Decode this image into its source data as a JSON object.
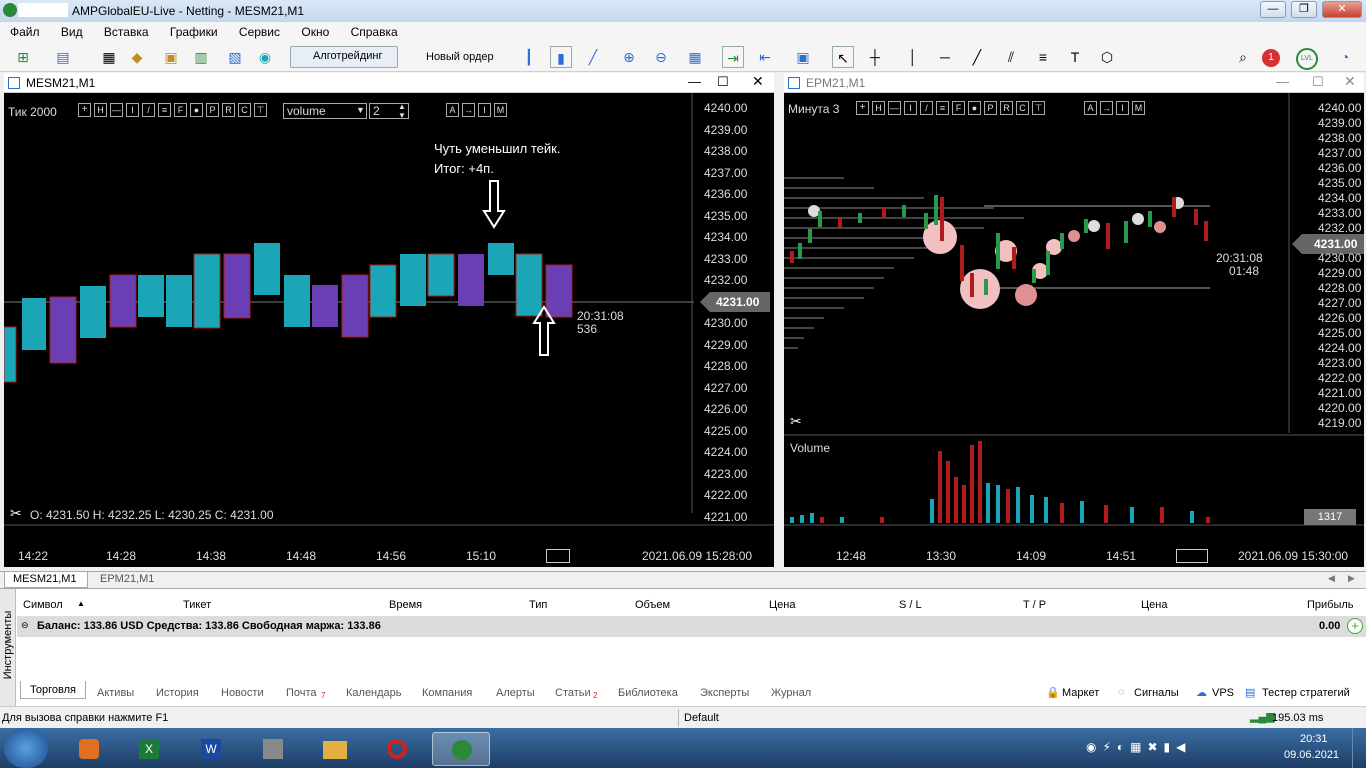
{
  "window": {
    "title": "AMPGlobalEU-Live - Netting - MESM21,M1"
  },
  "menu": [
    "Файл",
    "Вид",
    "Вставка",
    "Графики",
    "Сервис",
    "Окно",
    "Справка"
  ],
  "toolbar": {
    "algo_label": "Алготрейдинг",
    "new_order_label": "Новый ордер",
    "notif_count": "1",
    "lvl_label": "LVL"
  },
  "chart_left": {
    "title": "MESM21,M1",
    "timeframe": "Тик  2000",
    "indicator_select": "volume",
    "indicator_value": "2",
    "note_line1": "Чуть уменьшил тейк.",
    "note_line2": "Итог: +4п.",
    "ohlc": "O: 4231.50   H: 4232.25   L: 4230.25   C: 4231.00",
    "current_price": "4231.00",
    "timer": "20:31:08",
    "timer_sub": "536",
    "date_label": "2021.06.09 15:28:00",
    "price_ticks": [
      "4240.00",
      "4239.00",
      "4238.00",
      "4237.00",
      "4236.00",
      "4235.00",
      "4234.00",
      "4233.00",
      "4232.00",
      "4231.00",
      "4230.00",
      "4229.00",
      "4228.00",
      "4227.00",
      "4226.00",
      "4225.00",
      "4224.00",
      "4223.00",
      "4222.00",
      "4221.00"
    ],
    "time_ticks": [
      "14:22",
      "14:28",
      "14:38",
      "14:48",
      "14:56",
      "15:10"
    ]
  },
  "chart_right": {
    "title": "EPM21,M1",
    "timeframe": "Минута  3",
    "volume_label": "Volume",
    "current_price": "4231.00",
    "timer": "20:31:08",
    "timer_sub": "01:48",
    "volume_value": "1317",
    "date_label": "2021.06.09 15:30:00",
    "price_ticks": [
      "4240.00",
      "4239.00",
      "4238.00",
      "4237.00",
      "4236.00",
      "4235.00",
      "4234.00",
      "4233.00",
      "4232.00",
      "4231.00",
      "4230.00",
      "4229.00",
      "4228.00",
      "4227.00",
      "4226.00",
      "4225.00",
      "4224.00",
      "4223.00",
      "4222.00",
      "4221.00",
      "4220.00",
      "4219.00"
    ],
    "time_ticks": [
      "12:48",
      "13:30",
      "14:09",
      "14:51"
    ]
  },
  "chart_tabs": [
    "MESM21,M1",
    "EPM21,M1"
  ],
  "terminal": {
    "side_label": "Инструменты",
    "columns": [
      "Символ",
      "Тикет",
      "Время",
      "Тип",
      "Объем",
      "Цена",
      "S / L",
      "T / P",
      "Цена",
      "Прибыль"
    ],
    "balance_text": "Баланс: 133.86 USD  Средства: 133.86  Свободная маржа: 133.86",
    "profit": "0.00",
    "tabs": [
      "Торговля",
      "Активы",
      "История",
      "Новости",
      "Почта",
      "Календарь",
      "Компания",
      "Алерты",
      "Статьи",
      "Библиотека",
      "Эксперты",
      "Журнал"
    ],
    "mail_badge": "7",
    "articles_badge": "2",
    "right_links": [
      "Маркет",
      "Сигналы",
      "VPS",
      "Тестер стратегий"
    ]
  },
  "status": {
    "help": "Для вызова справки нажмите F1",
    "profile": "Default",
    "ping": "195.03 ms"
  },
  "taskbar": {
    "time": "20:31",
    "date": "09.06.2021"
  },
  "colors": {
    "teal": "#1aa6b7",
    "red": "#b01c1c",
    "purple": "#6a3fb3",
    "blue": "#2a6fd6"
  }
}
